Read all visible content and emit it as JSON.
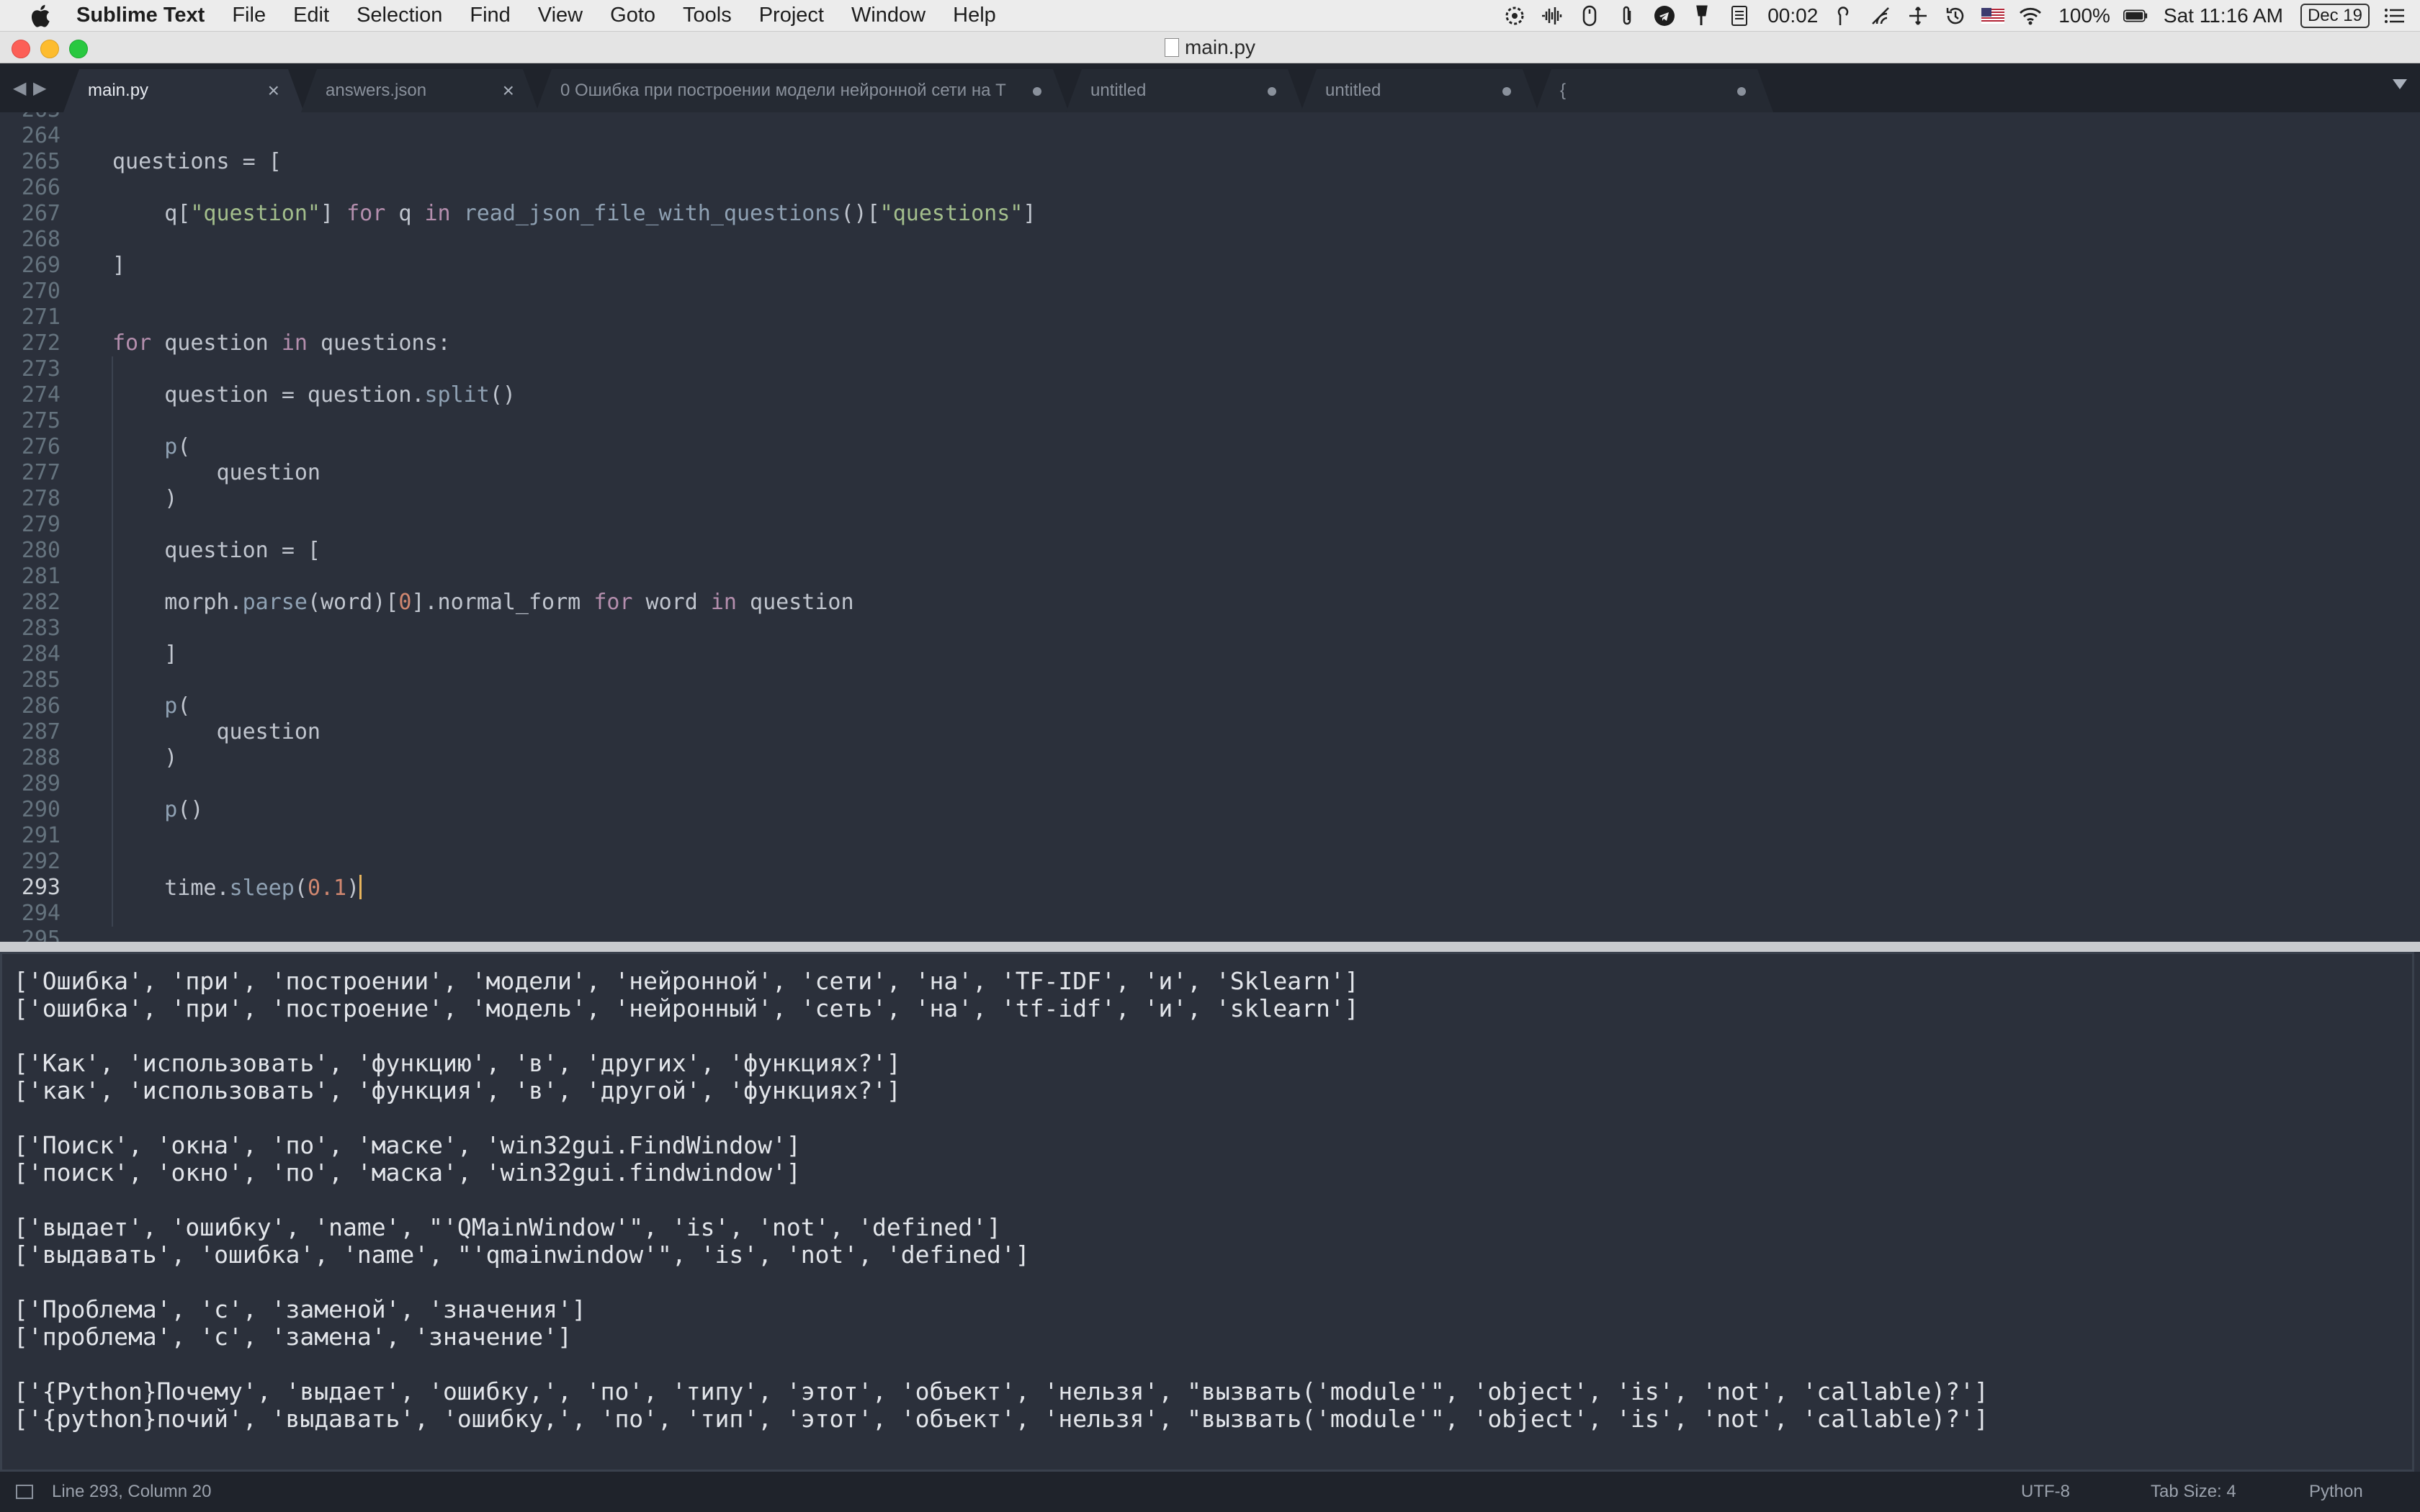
{
  "menubar": {
    "app_name": "Sublime Text",
    "items": [
      "File",
      "Edit",
      "Selection",
      "Find",
      "View",
      "Goto",
      "Tools",
      "Project",
      "Window",
      "Help"
    ],
    "status": {
      "timer": "00:02",
      "battery": "100%",
      "clock": "Sat 11:16 AM",
      "date": "Dec 19",
      "icons": [
        "gear-badge-icon",
        "audio-wave-icon",
        "mouse-icon",
        "paperclip-icon",
        "telegram-icon",
        "pin-icon",
        "notes-icon",
        "pencil-icon",
        "wifi-scan-icon",
        "move-icon",
        "time-machine-icon",
        "us-flag-icon",
        "wifi-icon",
        "battery-icon",
        "list-icon"
      ]
    }
  },
  "window": {
    "title": "main.py"
  },
  "tabs": [
    {
      "label": "main.py",
      "active": true,
      "state": "close"
    },
    {
      "label": "answers.json",
      "active": false,
      "state": "close"
    },
    {
      "label": "0 Ошибка при построении модели нейронной сети на T",
      "active": false,
      "state": "dirty"
    },
    {
      "label": "untitled",
      "active": false,
      "state": "dirty"
    },
    {
      "label": "untitled",
      "active": false,
      "state": "dirty"
    },
    {
      "label": "{",
      "active": false,
      "state": "dirty"
    }
  ],
  "editor": {
    "current_line": 293,
    "lines": [
      {
        "num": "263",
        "tokens": []
      },
      {
        "num": "264",
        "tokens": []
      },
      {
        "num": "265",
        "tokens": [
          [
            "plain",
            "questions "
          ],
          [
            "op",
            "="
          ],
          [
            "plain",
            " ["
          ]
        ]
      },
      {
        "num": "266",
        "tokens": []
      },
      {
        "num": "267",
        "tokens": [
          [
            "plain",
            "    q["
          ],
          [
            "str",
            "\"question\""
          ],
          [
            "plain",
            "] "
          ],
          [
            "kw",
            "for"
          ],
          [
            "plain",
            " q "
          ],
          [
            "kw",
            "in"
          ],
          [
            "plain",
            " "
          ],
          [
            "fn",
            "read_json_file_with_questions"
          ],
          [
            "plain",
            "()["
          ],
          [
            "str",
            "\"questions\""
          ],
          [
            "plain",
            "]"
          ]
        ]
      },
      {
        "num": "268",
        "tokens": []
      },
      {
        "num": "269",
        "tokens": [
          [
            "plain",
            "]"
          ]
        ]
      },
      {
        "num": "270",
        "tokens": []
      },
      {
        "num": "271",
        "tokens": []
      },
      {
        "num": "272",
        "tokens": [
          [
            "kw",
            "for"
          ],
          [
            "plain",
            " question "
          ],
          [
            "kw",
            "in"
          ],
          [
            "plain",
            " questions:"
          ]
        ]
      },
      {
        "num": "273",
        "tokens": []
      },
      {
        "num": "274",
        "tokens": [
          [
            "plain",
            "    question "
          ],
          [
            "op",
            "="
          ],
          [
            "plain",
            " question."
          ],
          [
            "fn",
            "split"
          ],
          [
            "plain",
            "()"
          ]
        ]
      },
      {
        "num": "275",
        "tokens": []
      },
      {
        "num": "276",
        "tokens": [
          [
            "plain",
            "    "
          ],
          [
            "fn",
            "p"
          ],
          [
            "plain",
            "("
          ]
        ]
      },
      {
        "num": "277",
        "tokens": [
          [
            "plain",
            "        question"
          ]
        ]
      },
      {
        "num": "278",
        "tokens": [
          [
            "plain",
            "    )"
          ]
        ]
      },
      {
        "num": "279",
        "tokens": []
      },
      {
        "num": "280",
        "tokens": [
          [
            "plain",
            "    question "
          ],
          [
            "op",
            "="
          ],
          [
            "plain",
            " ["
          ]
        ]
      },
      {
        "num": "281",
        "tokens": []
      },
      {
        "num": "282",
        "tokens": [
          [
            "plain",
            "    morph."
          ],
          [
            "fn",
            "parse"
          ],
          [
            "plain",
            "(word)["
          ],
          [
            "num",
            "0"
          ],
          [
            "plain",
            "].normal_form "
          ],
          [
            "kw",
            "for"
          ],
          [
            "plain",
            " word "
          ],
          [
            "kw",
            "in"
          ],
          [
            "plain",
            " question"
          ]
        ]
      },
      {
        "num": "283",
        "tokens": []
      },
      {
        "num": "284",
        "tokens": [
          [
            "plain",
            "    ]"
          ]
        ]
      },
      {
        "num": "285",
        "tokens": []
      },
      {
        "num": "286",
        "tokens": [
          [
            "plain",
            "    "
          ],
          [
            "fn",
            "p"
          ],
          [
            "plain",
            "("
          ]
        ]
      },
      {
        "num": "287",
        "tokens": [
          [
            "plain",
            "        question"
          ]
        ]
      },
      {
        "num": "288",
        "tokens": [
          [
            "plain",
            "    )"
          ]
        ]
      },
      {
        "num": "289",
        "tokens": []
      },
      {
        "num": "290",
        "tokens": [
          [
            "plain",
            "    "
          ],
          [
            "fn",
            "p"
          ],
          [
            "plain",
            "()"
          ]
        ]
      },
      {
        "num": "291",
        "tokens": []
      },
      {
        "num": "292",
        "tokens": []
      },
      {
        "num": "293",
        "tokens": [
          [
            "plain",
            "    time."
          ],
          [
            "fn",
            "sleep"
          ],
          [
            "plain",
            "("
          ],
          [
            "num",
            "0.1"
          ],
          [
            "plain",
            ")"
          ]
        ]
      },
      {
        "num": "294",
        "tokens": []
      },
      {
        "num": "295",
        "tokens": []
      }
    ]
  },
  "output": {
    "lines": [
      "['Ошибка', 'при', 'построении', 'модели', 'нейронной', 'сети', 'на', 'TF-IDF', 'и', 'Sklearn']",
      "['ошибка', 'при', 'построение', 'модель', 'нейронный', 'сеть', 'на', 'tf-idf', 'и', 'sklearn']",
      "",
      "['Как', 'использовать', 'функцию', 'в', 'других', 'функциях?']",
      "['как', 'использовать', 'функция', 'в', 'другой', 'функциях?']",
      "",
      "['Поиск', 'окна', 'по', 'маске', 'win32gui.FindWindow']",
      "['поиск', 'окно', 'по', 'маска', 'win32gui.findwindow']",
      "",
      "['выдает', 'ошибку', 'name', \"'QMainWindow'\", 'is', 'not', 'defined']",
      "['выдавать', 'ошибка', 'name', \"'qmainwindow'\", 'is', 'not', 'defined']",
      "",
      "['Проблема', 'с', 'заменой', 'значения']",
      "['проблема', 'с', 'замена', 'значение']",
      "",
      "['{Python}Почему', 'выдает', 'ошибку,', 'по', 'типу', 'этот', 'объект', 'нельзя', \"вызвать('module'\", 'object', 'is', 'not', 'callable)?']",
      "['{python}почий', 'выдавать', 'ошибку,', 'по', 'тип', 'этот', 'объект', 'нельзя', \"вызвать('module'\", 'object', 'is', 'not', 'callable)?']"
    ]
  },
  "statusbar": {
    "position": "Line 293, Column 20",
    "encoding": "UTF-8",
    "tab_size": "Tab Size: 4",
    "syntax": "Python"
  },
  "colors": {
    "editor_bg": "#2b303b",
    "string": "#a3be8c",
    "keyword": "#b48ead",
    "function": "#8fa1b3",
    "number": "#d08770",
    "caret": "#e8b45c"
  }
}
